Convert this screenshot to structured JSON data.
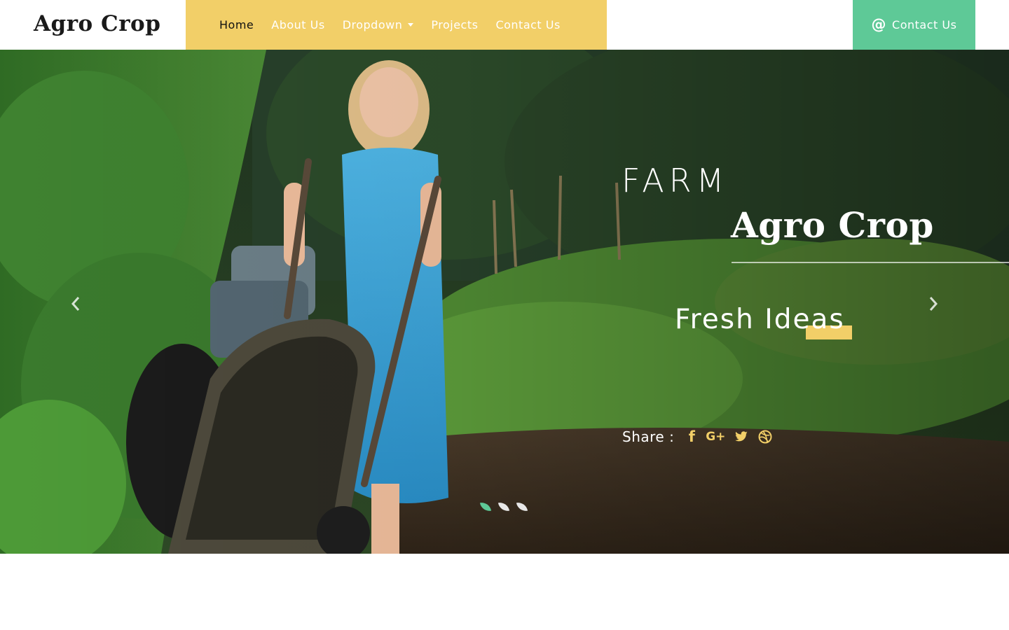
{
  "header": {
    "logo": "Agro Crop",
    "nav": [
      {
        "label": "Home",
        "active": true
      },
      {
        "label": "About Us"
      },
      {
        "label": "Dropdown",
        "has_caret": true
      },
      {
        "label": "Projects"
      },
      {
        "label": "Contact Us"
      }
    ],
    "cta": {
      "label": "Contact Us",
      "icon": "at-icon"
    }
  },
  "hero": {
    "tag": "FARM",
    "title": "Agro Crop",
    "subtitle": "Fresh Ideas",
    "share_label": "Share :",
    "share_icons": [
      "facebook-icon",
      "google-plus-icon",
      "twitter-icon",
      "dribbble-icon"
    ],
    "slide_count": 3,
    "active_slide": 1,
    "prev_icon": "chevron-left-icon",
    "next_icon": "chevron-right-icon"
  },
  "colors": {
    "accent_yellow": "#f2cf68",
    "accent_green": "#5ec997",
    "text_dark": "#1a1a1a",
    "white": "#ffffff"
  }
}
